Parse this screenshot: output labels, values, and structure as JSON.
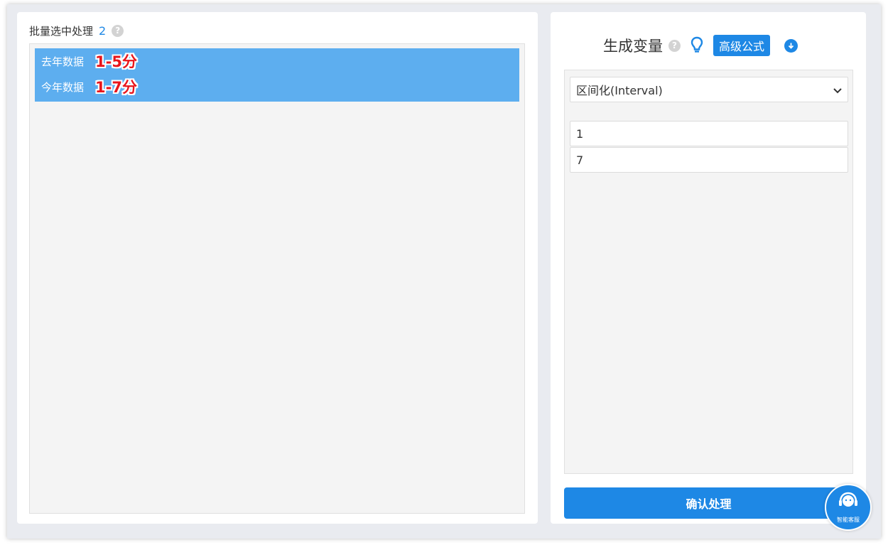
{
  "left_panel": {
    "title": "批量选中处理",
    "count": "2",
    "items": [
      {
        "label": "去年数据",
        "annotation": "1-5分"
      },
      {
        "label": "今年数据",
        "annotation": "1-7分"
      }
    ]
  },
  "right_panel": {
    "title": "生成变量",
    "advanced_formula_label": "高级公式",
    "method_select": {
      "selected": "区间化(Interval)"
    },
    "inputs": [
      {
        "value": "1"
      },
      {
        "value": "7"
      }
    ],
    "confirm_label": "确认处理"
  },
  "service_widget": {
    "label": "智能客服"
  },
  "colors": {
    "accent": "#1e88e5",
    "selection": "#5daeef",
    "annotation": "#e8151b"
  }
}
